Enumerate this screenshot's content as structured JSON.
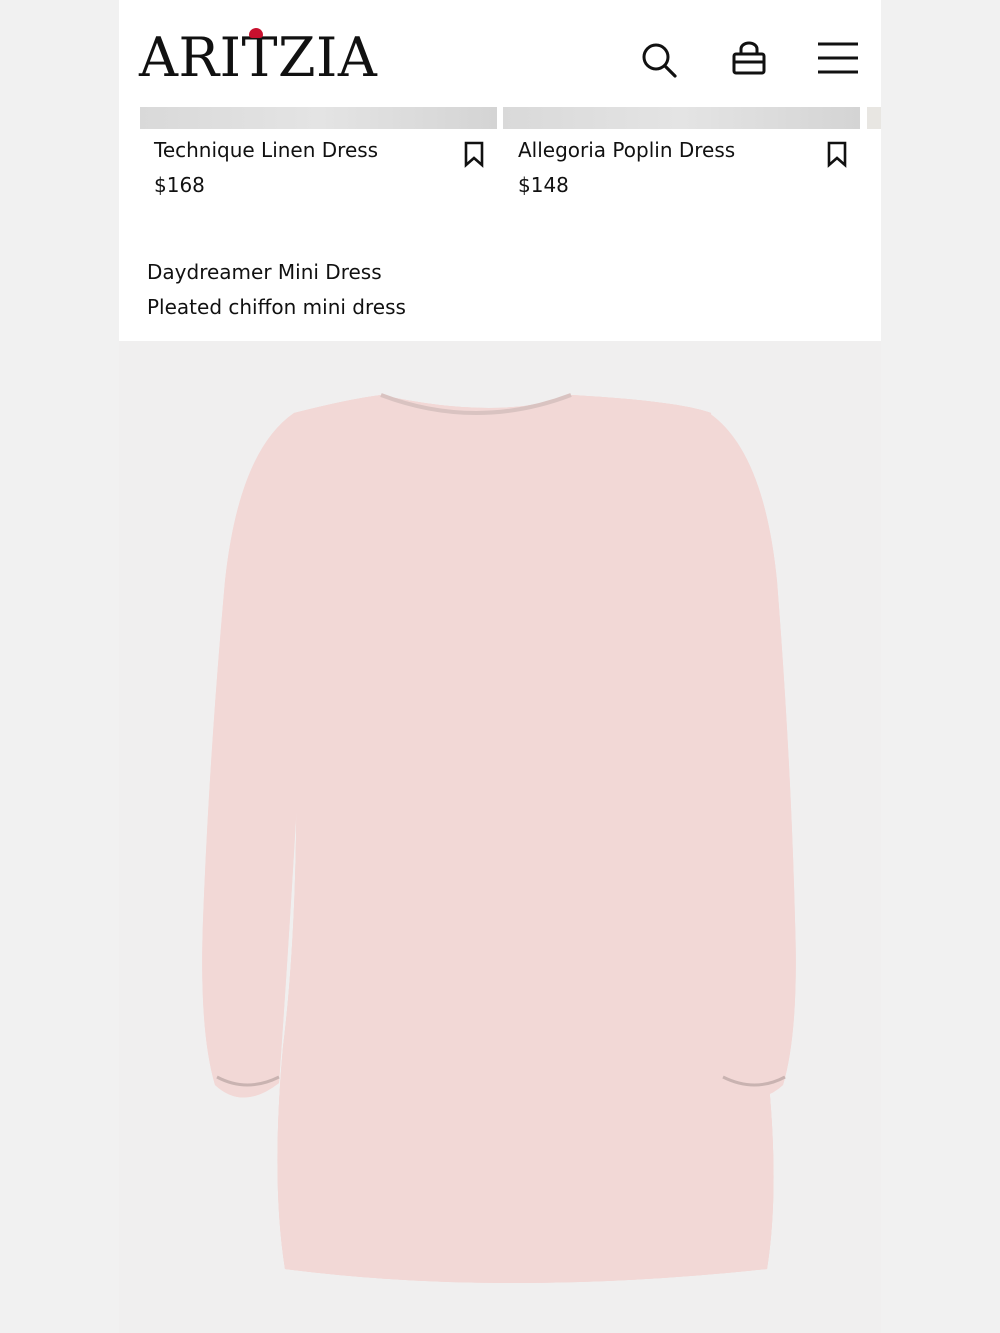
{
  "brand": {
    "logo_text": "ARITZIA",
    "accent_color": "#c8102e"
  },
  "header": {
    "icons": [
      "search-icon",
      "shopping-bag-icon",
      "menu-icon"
    ]
  },
  "carousel": {
    "cards": [
      {
        "name": "Technique Linen Dress",
        "price": "$168"
      },
      {
        "name": "Allegoria Poplin Dress",
        "price": "$148"
      }
    ]
  },
  "product": {
    "name": "Daydreamer Mini Dress",
    "description": "Pleated chiffon mini dress",
    "colors": {
      "base": "#f2d8d6",
      "pink": "#eba9a6",
      "green": "#8a9a7e"
    }
  }
}
